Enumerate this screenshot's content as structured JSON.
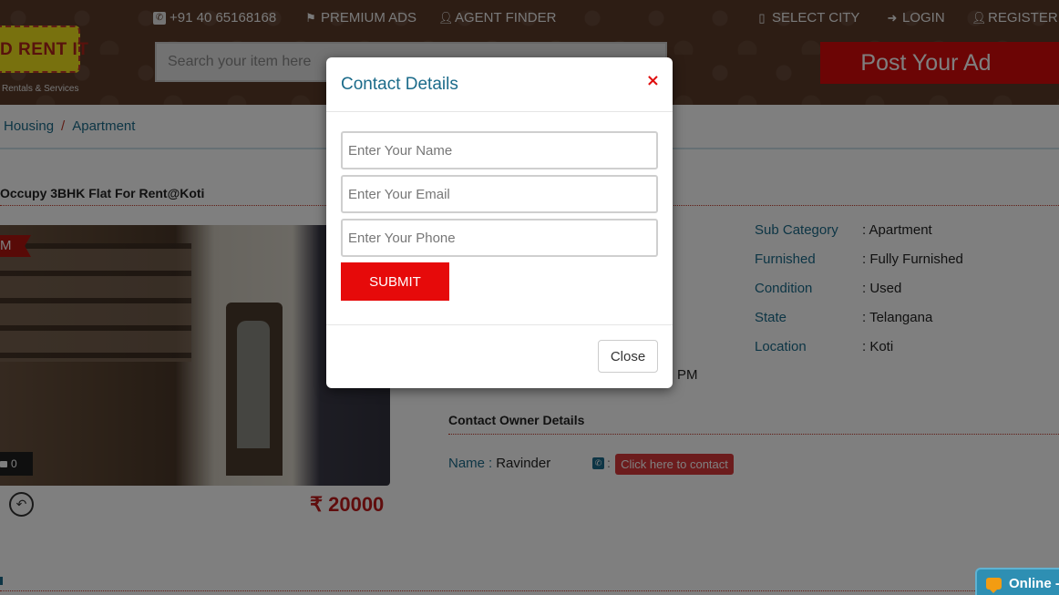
{
  "header": {
    "logo_text": "D RENT IT",
    "logo_tagline": "Rentals & Services",
    "phone": "+91 40 65168168",
    "nav": [
      {
        "label": "PREMIUM ADS",
        "icon": "flag-icon"
      },
      {
        "label": "AGENT FINDER",
        "icon": "user-icon"
      },
      {
        "label": "SELECT CITY",
        "icon": "tablet-icon"
      },
      {
        "label": "LOGIN",
        "icon": "sign-in-icon"
      },
      {
        "label": "REGISTER",
        "icon": "user-plus-icon"
      }
    ],
    "search_placeholder": "Search your item here",
    "post_ad_label": "Post Your Ad"
  },
  "breadcrumb": {
    "items": [
      "Housing",
      "Apartment"
    ],
    "separator": "/"
  },
  "listing": {
    "title": "Occupy 3BHK Flat For Rent@Koti",
    "ribbon": "M",
    "photo_count": "0",
    "price": "₹ 20000",
    "details": [
      {
        "label": "Sub Category",
        "value": ": Apartment"
      },
      {
        "label": "Furnished",
        "value": ": Fully Furnished"
      },
      {
        "label": "Condition",
        "value": ": Used"
      },
      {
        "label": "State",
        "value": ": Telangana"
      },
      {
        "label": "Location",
        "value": ": Koti"
      }
    ],
    "partial_time_text": "PM"
  },
  "owner": {
    "section_title": "Contact Owner Details",
    "name_label": "Name",
    "name_sep": ":",
    "name_value": "Ravinder",
    "phone_sep": ":",
    "contact_button": "Click here to contact"
  },
  "modal": {
    "title": "Contact Details",
    "close_x": "×",
    "name_placeholder": "Enter Your Name",
    "email_placeholder": "Enter Your Email",
    "phone_placeholder": "Enter Your Phone",
    "submit_label": "SUBMIT",
    "close_label": "Close"
  },
  "chat": {
    "label": "Online -"
  },
  "colors": {
    "brand_red": "#d90b0b",
    "link_teal": "#1b6b8a",
    "header_brown": "#5a3a28",
    "submit_red": "#e60a0a"
  }
}
